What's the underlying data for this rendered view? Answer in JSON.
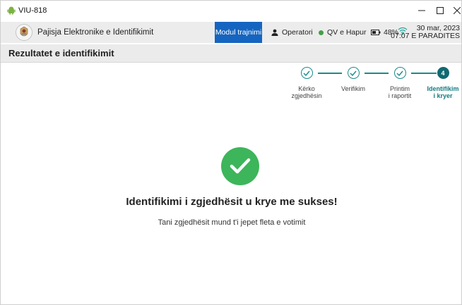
{
  "window": {
    "title": "VIU-818",
    "controls": [
      "minimize",
      "maximize",
      "close"
    ]
  },
  "appbar": {
    "app_name": "Pajisja Elektronike e Identifikimit",
    "modul_button": "Modul trajnimi",
    "operator": "Operatori",
    "qv_status": "QV e Hapur",
    "battery": "48%",
    "date": "30 mar, 2023",
    "time": "07:07 E PARADITES",
    "colors": {
      "accent": "#1565c0",
      "status_ok": "#43a047"
    }
  },
  "page": {
    "title": "Rezultatet e identifikimit"
  },
  "stepper": {
    "steps": [
      {
        "label_1": "Kërko",
        "label_2": "zgjedhësin",
        "state": "done"
      },
      {
        "label_1": "Verifikim",
        "label_2": "",
        "state": "done"
      },
      {
        "label_1": "Printim",
        "label_2": "i raportit",
        "state": "done"
      },
      {
        "number": "4",
        "label_1": "Identifikim",
        "label_2": "i kryer",
        "state": "active"
      }
    ],
    "colors": {
      "done": "#1a8a8a",
      "active": "#106a70"
    }
  },
  "result": {
    "icon": "check-circle-icon",
    "headline": "Identifikimi i zgjedhësit u krye me sukses!",
    "subline": "Tani zgjedhësit mund t'i jepet fleta e votimit",
    "color": "#3db55b"
  }
}
